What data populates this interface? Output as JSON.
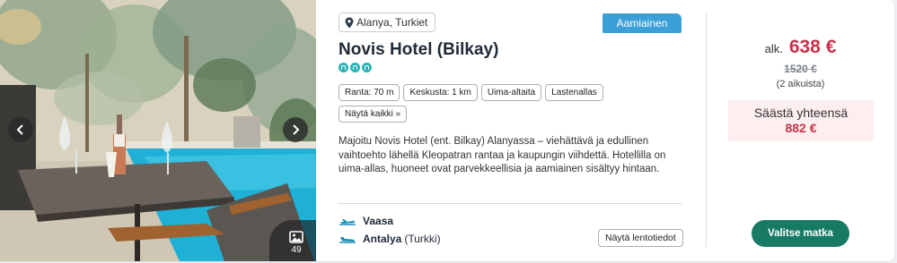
{
  "hotel": {
    "location": "Alanya, Turkiet",
    "board": "Aamiainen",
    "name": "Novis Hotel (Bilkay)",
    "rating_icons": 3,
    "tags": [
      "Ranta: 70 m",
      "Keskusta: 1 km",
      "Uima-altaita",
      "Lastenallas",
      "Näytä kaikki »"
    ],
    "description": "Majoitu Novis Hotel (ent. Bilkay) Alanyassa – viehättävä ja edullinen vaihtoehto lähellä Kleopatran rantaa ja kaupungin viihdettä. Hotellilla on uima-allas, huoneet ovat parvekkeellisia ja aamiainen sisältyy hintaan."
  },
  "gallery": {
    "count": "49",
    "icon": "image-icon"
  },
  "flights": {
    "departure_city": "Vaasa",
    "arrival_city": "Antalya",
    "arrival_country": "(Turkki)",
    "details_label": "Näytä lentotiedot"
  },
  "price": {
    "from_label": "alk.",
    "amount": "638 €",
    "old_amount": "1520 €",
    "persons": "(2 aikuista)",
    "save_label": "Säästä yhteensä",
    "save_amount": "882 €",
    "select_label": "Valitse matka"
  },
  "colors": {
    "accent_price": "#c8334c",
    "board_badge": "#3b9fd8",
    "cta": "#177a64",
    "rating": "#2ab1b7"
  }
}
